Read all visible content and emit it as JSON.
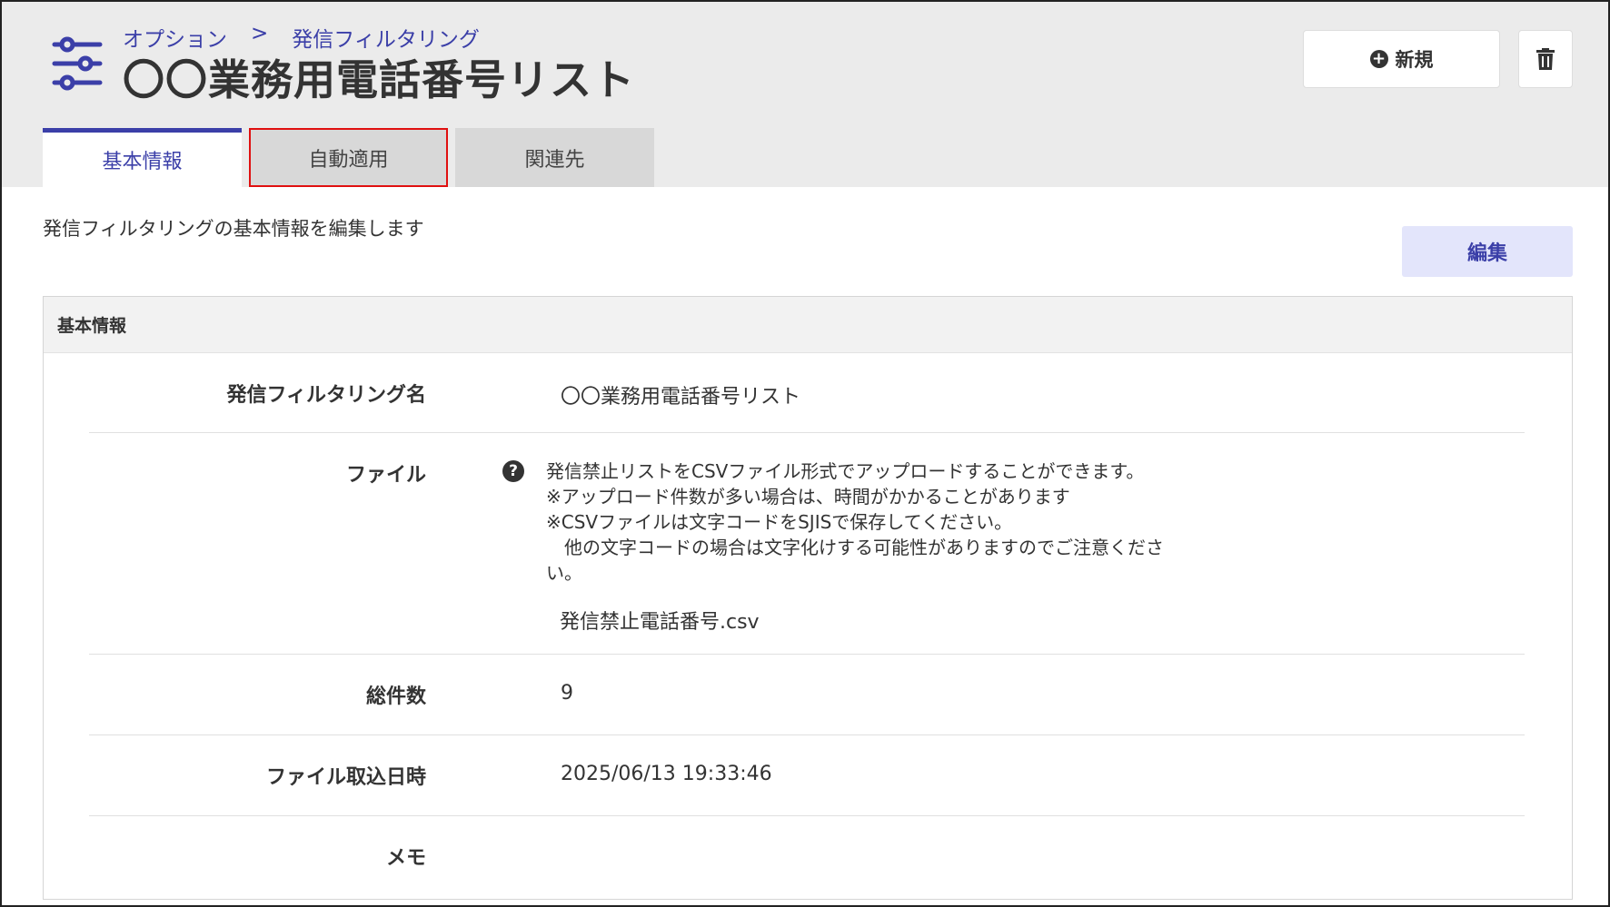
{
  "breadcrumb": {
    "parent": "オプション",
    "separator": ">",
    "current": "発信フィルタリング"
  },
  "page": {
    "title": "〇〇業務用電話番号リスト",
    "icon": "sliders-icon"
  },
  "toolbar": {
    "new_label": "新規",
    "new_icon": "plus-circle-icon",
    "delete_icon": "trash-icon"
  },
  "tabs": [
    {
      "label": "基本情報",
      "active": true
    },
    {
      "label": "自動適用",
      "active": false,
      "highlighted": true
    },
    {
      "label": "関連先",
      "active": false
    }
  ],
  "description": "発信フィルタリングの基本情報を編集します",
  "edit_label": "編集",
  "section": {
    "title": "基本情報",
    "fields": {
      "name": {
        "label": "発信フィルタリング名",
        "value": "〇〇業務用電話番号リスト"
      },
      "file": {
        "label": "ファイル",
        "help_icon": "question-circle-icon",
        "notes": [
          "発信禁止リストをCSVファイル形式でアップロードすることができます。",
          "※アップロード件数が多い場合は、時間がかかることがあります",
          "※CSVファイルは文字コードをSJISで保存してください。",
          "　他の文字コードの場合は文字化けする可能性がありますのでご注意くださ",
          "い。"
        ],
        "value": "発信禁止電話番号.csv"
      },
      "total": {
        "label": "総件数",
        "value": "9"
      },
      "imported_at": {
        "label": "ファイル取込日時",
        "value": "2025/06/13 19:33:46"
      },
      "memo": {
        "label": "メモ",
        "value": ""
      }
    }
  },
  "colors": {
    "accent": "#3b3fa8",
    "header_bg": "#ebebeb",
    "highlight": "#e01010",
    "edit_bg": "#e3e5fb"
  }
}
